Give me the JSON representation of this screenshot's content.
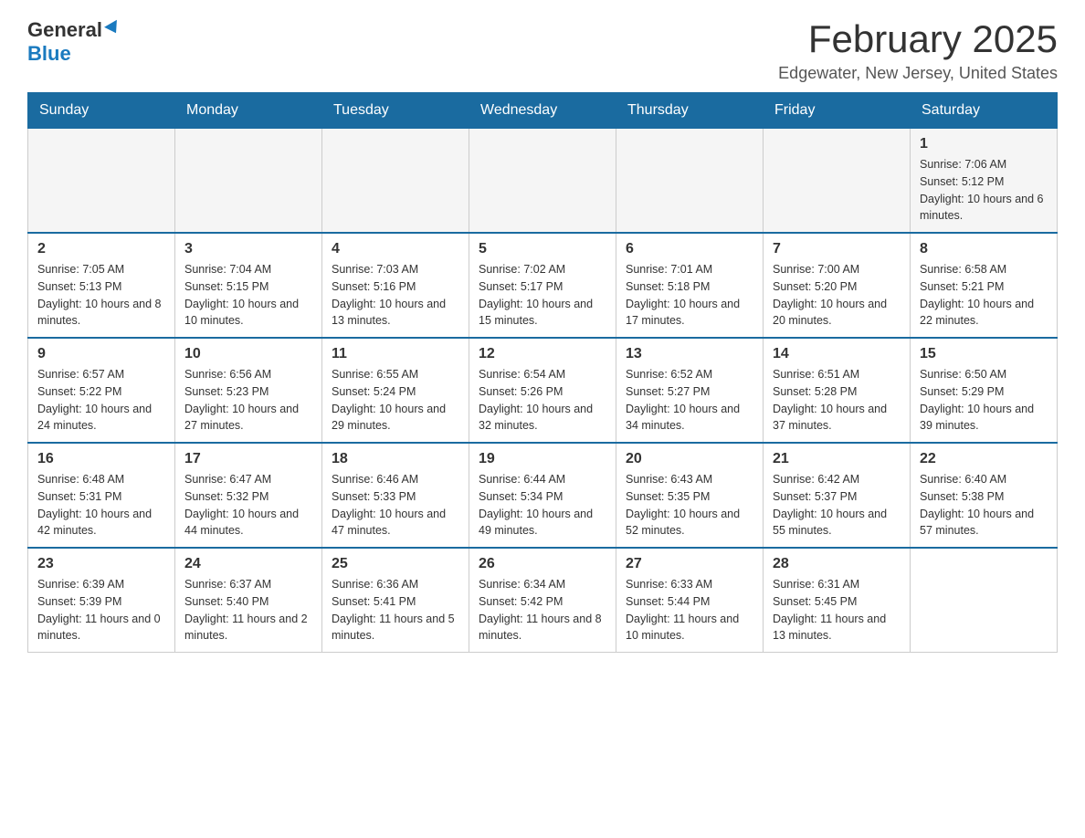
{
  "header": {
    "logo_general": "General",
    "logo_blue": "Blue",
    "month_title": "February 2025",
    "location": "Edgewater, New Jersey, United States"
  },
  "days_of_week": [
    "Sunday",
    "Monday",
    "Tuesday",
    "Wednesday",
    "Thursday",
    "Friday",
    "Saturday"
  ],
  "weeks": [
    {
      "days": [
        {
          "date": "",
          "info": ""
        },
        {
          "date": "",
          "info": ""
        },
        {
          "date": "",
          "info": ""
        },
        {
          "date": "",
          "info": ""
        },
        {
          "date": "",
          "info": ""
        },
        {
          "date": "",
          "info": ""
        },
        {
          "date": "1",
          "info": "Sunrise: 7:06 AM\nSunset: 5:12 PM\nDaylight: 10 hours and 6 minutes."
        }
      ]
    },
    {
      "days": [
        {
          "date": "2",
          "info": "Sunrise: 7:05 AM\nSunset: 5:13 PM\nDaylight: 10 hours and 8 minutes."
        },
        {
          "date": "3",
          "info": "Sunrise: 7:04 AM\nSunset: 5:15 PM\nDaylight: 10 hours and 10 minutes."
        },
        {
          "date": "4",
          "info": "Sunrise: 7:03 AM\nSunset: 5:16 PM\nDaylight: 10 hours and 13 minutes."
        },
        {
          "date": "5",
          "info": "Sunrise: 7:02 AM\nSunset: 5:17 PM\nDaylight: 10 hours and 15 minutes."
        },
        {
          "date": "6",
          "info": "Sunrise: 7:01 AM\nSunset: 5:18 PM\nDaylight: 10 hours and 17 minutes."
        },
        {
          "date": "7",
          "info": "Sunrise: 7:00 AM\nSunset: 5:20 PM\nDaylight: 10 hours and 20 minutes."
        },
        {
          "date": "8",
          "info": "Sunrise: 6:58 AM\nSunset: 5:21 PM\nDaylight: 10 hours and 22 minutes."
        }
      ]
    },
    {
      "days": [
        {
          "date": "9",
          "info": "Sunrise: 6:57 AM\nSunset: 5:22 PM\nDaylight: 10 hours and 24 minutes."
        },
        {
          "date": "10",
          "info": "Sunrise: 6:56 AM\nSunset: 5:23 PM\nDaylight: 10 hours and 27 minutes."
        },
        {
          "date": "11",
          "info": "Sunrise: 6:55 AM\nSunset: 5:24 PM\nDaylight: 10 hours and 29 minutes."
        },
        {
          "date": "12",
          "info": "Sunrise: 6:54 AM\nSunset: 5:26 PM\nDaylight: 10 hours and 32 minutes."
        },
        {
          "date": "13",
          "info": "Sunrise: 6:52 AM\nSunset: 5:27 PM\nDaylight: 10 hours and 34 minutes."
        },
        {
          "date": "14",
          "info": "Sunrise: 6:51 AM\nSunset: 5:28 PM\nDaylight: 10 hours and 37 minutes."
        },
        {
          "date": "15",
          "info": "Sunrise: 6:50 AM\nSunset: 5:29 PM\nDaylight: 10 hours and 39 minutes."
        }
      ]
    },
    {
      "days": [
        {
          "date": "16",
          "info": "Sunrise: 6:48 AM\nSunset: 5:31 PM\nDaylight: 10 hours and 42 minutes."
        },
        {
          "date": "17",
          "info": "Sunrise: 6:47 AM\nSunset: 5:32 PM\nDaylight: 10 hours and 44 minutes."
        },
        {
          "date": "18",
          "info": "Sunrise: 6:46 AM\nSunset: 5:33 PM\nDaylight: 10 hours and 47 minutes."
        },
        {
          "date": "19",
          "info": "Sunrise: 6:44 AM\nSunset: 5:34 PM\nDaylight: 10 hours and 49 minutes."
        },
        {
          "date": "20",
          "info": "Sunrise: 6:43 AM\nSunset: 5:35 PM\nDaylight: 10 hours and 52 minutes."
        },
        {
          "date": "21",
          "info": "Sunrise: 6:42 AM\nSunset: 5:37 PM\nDaylight: 10 hours and 55 minutes."
        },
        {
          "date": "22",
          "info": "Sunrise: 6:40 AM\nSunset: 5:38 PM\nDaylight: 10 hours and 57 minutes."
        }
      ]
    },
    {
      "days": [
        {
          "date": "23",
          "info": "Sunrise: 6:39 AM\nSunset: 5:39 PM\nDaylight: 11 hours and 0 minutes."
        },
        {
          "date": "24",
          "info": "Sunrise: 6:37 AM\nSunset: 5:40 PM\nDaylight: 11 hours and 2 minutes."
        },
        {
          "date": "25",
          "info": "Sunrise: 6:36 AM\nSunset: 5:41 PM\nDaylight: 11 hours and 5 minutes."
        },
        {
          "date": "26",
          "info": "Sunrise: 6:34 AM\nSunset: 5:42 PM\nDaylight: 11 hours and 8 minutes."
        },
        {
          "date": "27",
          "info": "Sunrise: 6:33 AM\nSunset: 5:44 PM\nDaylight: 11 hours and 10 minutes."
        },
        {
          "date": "28",
          "info": "Sunrise: 6:31 AM\nSunset: 5:45 PM\nDaylight: 11 hours and 13 minutes."
        },
        {
          "date": "",
          "info": ""
        }
      ]
    }
  ]
}
